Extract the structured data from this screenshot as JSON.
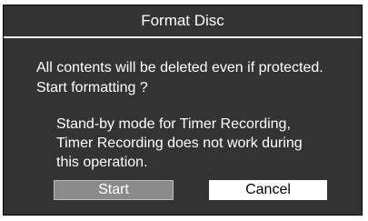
{
  "dialog": {
    "title": "Format Disc",
    "message_lines": [
      "All contents will be deleted even if protected.",
      "Start formatting ?"
    ],
    "note_lines": [
      "Stand-by mode for Timer Recording,",
      "Timer Recording does not work during",
      "this operation."
    ],
    "buttons": {
      "start_label": "Start",
      "cancel_label": "Cancel",
      "selected": "Start"
    }
  },
  "colors": {
    "dialog_background": "#333333",
    "selected_button": "#8a8a8a",
    "unselected_button": "#ffffff",
    "text": "#ffffff"
  }
}
